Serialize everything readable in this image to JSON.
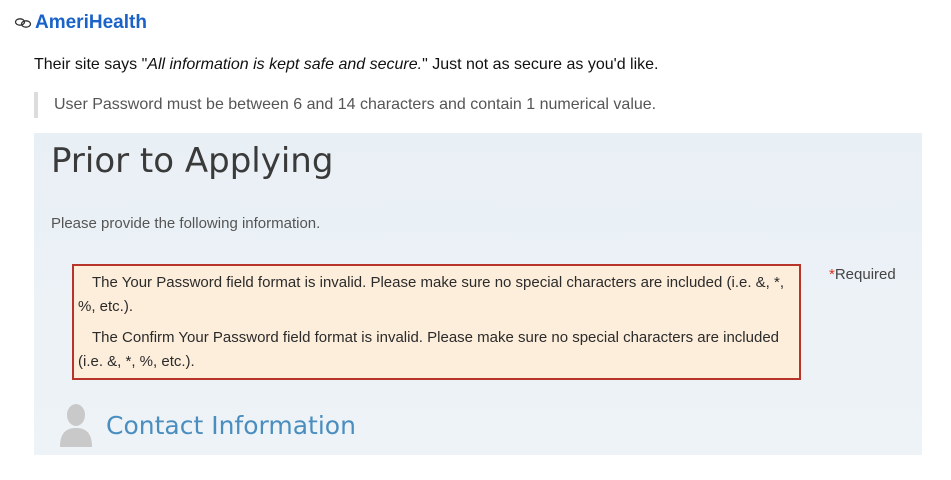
{
  "header": {
    "site_name": "AmeriHealth",
    "icon": "link-icon"
  },
  "intro": {
    "prefix": "Their site says \"",
    "quote": "All information is kept safe and secure.",
    "suffix": "\" Just not as secure as you'd like."
  },
  "blockquote": "User Password must be between 6 and 14 characters and contain 1 numerical value.",
  "form": {
    "title": "Prior to Applying",
    "instructions": "Please provide the following information.",
    "required_star": "*",
    "required_label": "Required",
    "errors": [
      "The Your Password field format is invalid. Please make sure no special characters are included (i.e. &, *, %, etc.).",
      "The Confirm Your Password field format is invalid. Please make sure no special characters are included (i.e. &, *, %, etc.)."
    ],
    "section_title": "Contact Information",
    "section_icon": "person-icon"
  },
  "colors": {
    "link": "#1a62c9",
    "error_border": "#b8342a",
    "error_bg": "#fdeedb",
    "section_title": "#4a8ebf",
    "required_star": "#d9321c"
  }
}
